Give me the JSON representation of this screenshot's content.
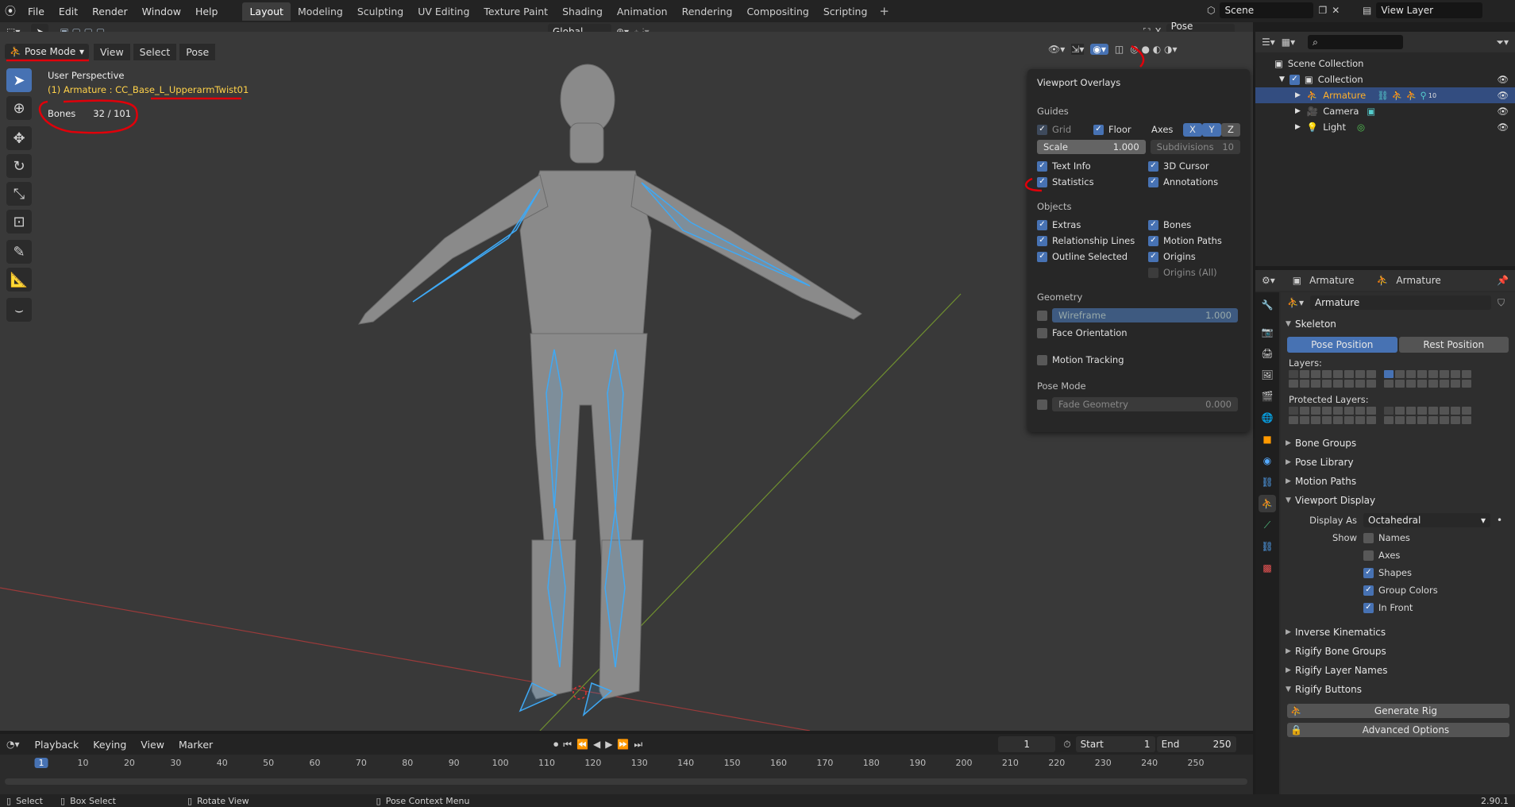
{
  "topbar": {
    "menus": [
      "File",
      "Edit",
      "Render",
      "Window",
      "Help"
    ],
    "workspaces": [
      "Layout",
      "Modeling",
      "Sculpting",
      "UV Editing",
      "Texture Paint",
      "Shading",
      "Animation",
      "Rendering",
      "Compositing",
      "Scripting"
    ],
    "active_workspace": "Layout",
    "scene": "Scene",
    "view_layer": "View Layer"
  },
  "viewport": {
    "mode": "Pose Mode",
    "menus": [
      "View",
      "Select",
      "Pose"
    ],
    "transform": "Global",
    "pose_options": "Pose Options",
    "perspective": "User Perspective",
    "active": "(1) Armature : CC_Base_L_UpperarmTwist01",
    "stats_label": "Bones",
    "stats_value": "32 / 101"
  },
  "overlays": {
    "title": "Viewport Overlays",
    "guides": "Guides",
    "grid": "Grid",
    "floor": "Floor",
    "axes": "Axes",
    "ax": [
      "X",
      "Y",
      "Z"
    ],
    "scale_label": "Scale",
    "scale_value": "1.000",
    "subdiv_label": "Subdivisions",
    "subdiv_value": "10",
    "text_info": "Text Info",
    "cursor": "3D Cursor",
    "statistics": "Statistics",
    "annotations": "Annotations",
    "objects": "Objects",
    "extras": "Extras",
    "bones": "Bones",
    "rel_lines": "Relationship Lines",
    "motion_paths": "Motion Paths",
    "outline": "Outline Selected",
    "origins": "Origins",
    "origins_all": "Origins (All)",
    "geometry": "Geometry",
    "wireframe": "Wireframe",
    "wire_value": "1.000",
    "face_orient": "Face Orientation",
    "motion_tracking": "Motion Tracking",
    "pose_mode": "Pose Mode",
    "fade": "Fade Geometry",
    "fade_value": "0.000"
  },
  "outliner": {
    "root": "Scene Collection",
    "collection": "Collection",
    "items": [
      "Armature",
      "Camera",
      "Light"
    ],
    "badge": "10"
  },
  "properties": {
    "ctx1": "Armature",
    "ctx2": "Armature",
    "name": "Armature",
    "skeleton": "Skeleton",
    "pose_position": "Pose Position",
    "rest_position": "Rest Position",
    "layers": "Layers:",
    "protected": "Protected Layers:",
    "panels1": [
      "Bone Groups",
      "Pose Library",
      "Motion Paths"
    ],
    "viewport_display": "Viewport Display",
    "display_as_label": "Display As",
    "display_as": "Octahedral",
    "show": "Show",
    "show_items": [
      "Names",
      "Axes",
      "Shapes",
      "Group Colors",
      "In Front"
    ],
    "panels2": [
      "Inverse Kinematics",
      "Rigify Bone Groups",
      "Rigify Layer Names"
    ],
    "rigify_buttons": "Rigify Buttons",
    "generate": "Generate Rig",
    "advanced": "Advanced Options"
  },
  "timeline": {
    "menus": [
      "Playback",
      "Keying",
      "View",
      "Marker"
    ],
    "frame": "1",
    "start_label": "Start",
    "start": "1",
    "end_label": "End",
    "end": "250",
    "ticks": [
      "1",
      "10",
      "20",
      "30",
      "40",
      "50",
      "60",
      "70",
      "80",
      "90",
      "100",
      "110",
      "120",
      "130",
      "140",
      "150",
      "160",
      "170",
      "180",
      "190",
      "200",
      "210",
      "220",
      "230",
      "240",
      "250"
    ]
  },
  "status": {
    "select": "Select",
    "box": "Box Select",
    "rotate": "Rotate View",
    "ctx": "Pose Context Menu",
    "version": "2.90.1"
  }
}
